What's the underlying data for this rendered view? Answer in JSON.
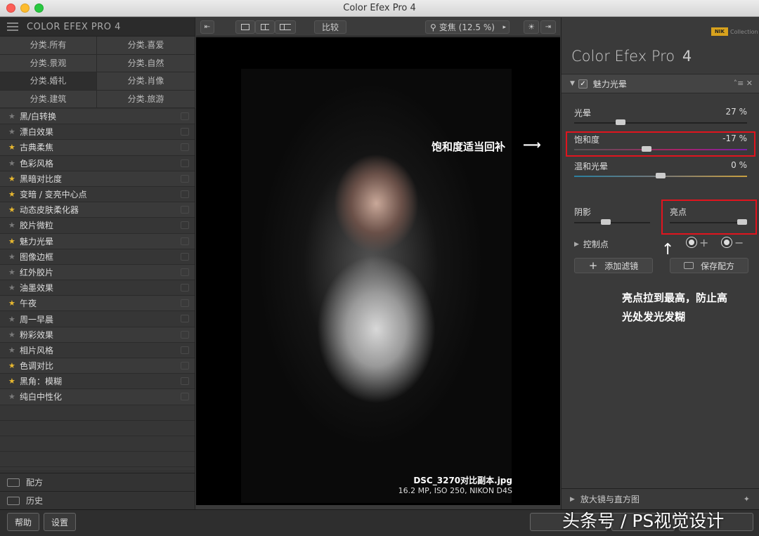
{
  "window": {
    "title": "Color Efex Pro 4"
  },
  "left_panel": {
    "header": "COLOR EFEX PRO 4",
    "categories": [
      "分类.所有",
      "分类.喜爱",
      "分类.景观",
      "分类.自然",
      "分类.婚礼",
      "分类.肖像",
      "分类.建筑",
      "分类.旅游"
    ],
    "filters": [
      {
        "name": "黑/白转换",
        "fav": false
      },
      {
        "name": "漂白效果",
        "fav": false
      },
      {
        "name": "古典柔焦",
        "fav": true
      },
      {
        "name": "色彩风格",
        "fav": false
      },
      {
        "name": "黑暗对比度",
        "fav": true
      },
      {
        "name": "变暗 / 变亮中心点",
        "fav": true
      },
      {
        "name": "动态皮肤柔化器",
        "fav": true
      },
      {
        "name": "胶片微粒",
        "fav": false
      },
      {
        "name": "魅力光晕",
        "fav": true
      },
      {
        "name": "图像边框",
        "fav": false
      },
      {
        "name": "红外胶片",
        "fav": false
      },
      {
        "name": "油墨效果",
        "fav": false
      },
      {
        "name": "午夜",
        "fav": true
      },
      {
        "name": "周一早晨",
        "fav": false
      },
      {
        "name": "粉彩效果",
        "fav": false
      },
      {
        "name": "相片风格",
        "fav": false
      },
      {
        "name": "色调对比",
        "fav": true
      },
      {
        "name": "黑角：模糊",
        "fav": true
      },
      {
        "name": "纯白中性化",
        "fav": false
      }
    ],
    "tabs": {
      "recipes": "配方",
      "history": "历史"
    }
  },
  "toolbar": {
    "compare": "比较",
    "zoom": "变焦 (12.5 %)"
  },
  "canvas": {
    "annotation_saturation": "饱和度适当回补",
    "annotation_highlight_1": "亮点拉到最高，防止高",
    "annotation_highlight_2": "光处发光发糊",
    "filename": "DSC_3270对比副本.jpg",
    "meta": "16.2 MP, ISO 250, NIKON D4S"
  },
  "right_panel": {
    "logo": "NIK",
    "logo_sub": "Collection",
    "app_name": "Color Efex Pro",
    "app_version": "4",
    "filter_title": "魅力光晕",
    "filter_ctrls": "˄≡ ✕",
    "sliders": {
      "glow": {
        "label": "光晕",
        "value": "27 %",
        "pos": 0.27
      },
      "saturation": {
        "label": "饱和度",
        "value": "-17 %",
        "pos": 0.42
      },
      "warmth": {
        "label": "温和光晕",
        "value": "0 %",
        "pos": 0.5
      },
      "shadows": {
        "label": "阴影",
        "pos": 0.42
      },
      "highlights": {
        "label": "亮点",
        "pos": 1.0
      }
    },
    "control_points": "控制点",
    "add_filter": "添加滤镜",
    "save_recipe": "保存配方",
    "magnifier": "放大镜与直方图"
  },
  "bottom": {
    "help": "帮助",
    "settings": "设置",
    "watermark": "头条号 / PS视觉设计"
  }
}
